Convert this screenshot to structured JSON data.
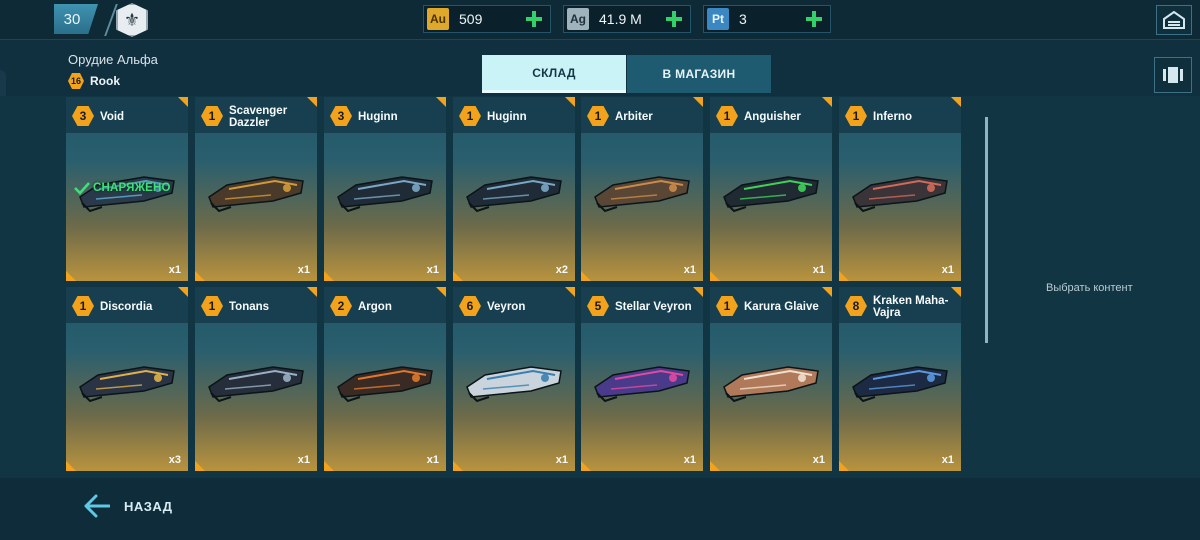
{
  "topbar": {
    "player_level": "30",
    "currencies": [
      {
        "code": "Au",
        "value": "509",
        "color": "#e0a82a"
      },
      {
        "code": "Ag",
        "value": "41.9 M",
        "color": "#9fb3bd"
      },
      {
        "code": "Pt",
        "value": "3",
        "color": "#3b87c2"
      }
    ]
  },
  "header": {
    "slot_title": "Орудие Альфа",
    "robot_level": "16",
    "robot_name": "Rook"
  },
  "tabs": [
    {
      "label": "СКЛАД",
      "active": true
    },
    {
      "label": "В МАГАЗИН",
      "active": false
    }
  ],
  "equipped_label": "СНАРЯЖЕНО",
  "items": [
    {
      "level": "3",
      "name": "Void",
      "qty": "x1",
      "equipped": true,
      "icon": "void-weapon-icon"
    },
    {
      "level": "1",
      "name": "Scavenger Dazzler",
      "qty": "x1",
      "icon": "scavenger-dazzler-weapon-icon"
    },
    {
      "level": "3",
      "name": "Huginn",
      "qty": "x1",
      "icon": "huginn-weapon-icon"
    },
    {
      "level": "1",
      "name": "Huginn",
      "qty": "x2",
      "icon": "huginn-weapon-icon"
    },
    {
      "level": "1",
      "name": "Arbiter",
      "qty": "x1",
      "icon": "arbiter-weapon-icon"
    },
    {
      "level": "1",
      "name": "Anguisher",
      "qty": "x1",
      "icon": "anguisher-weapon-icon"
    },
    {
      "level": "1",
      "name": "Inferno",
      "qty": "x1",
      "icon": "inferno-weapon-icon"
    },
    {
      "level": "1",
      "name": "Discordia",
      "qty": "x3",
      "icon": "discordia-weapon-icon"
    },
    {
      "level": "1",
      "name": "Tonans",
      "qty": "x1",
      "icon": "tonans-weapon-icon"
    },
    {
      "level": "2",
      "name": "Argon",
      "qty": "x1",
      "icon": "argon-weapon-icon"
    },
    {
      "level": "6",
      "name": "Veyron",
      "qty": "x1",
      "icon": "veyron-weapon-icon"
    },
    {
      "level": "5",
      "name": "Stellar Veyron",
      "qty": "x1",
      "icon": "stellar-veyron-weapon-icon"
    },
    {
      "level": "1",
      "name": "Karura Glaive",
      "qty": "x1",
      "icon": "karura-glaive-weapon-icon"
    },
    {
      "level": "8",
      "name": "Kraken Maha-Vajra",
      "qty": "x1",
      "icon": "kraken-maha-vajra-weapon-icon"
    }
  ],
  "side_panel": {
    "hint": "Выбрать контент"
  },
  "footer": {
    "back_label": "НАЗАД"
  }
}
